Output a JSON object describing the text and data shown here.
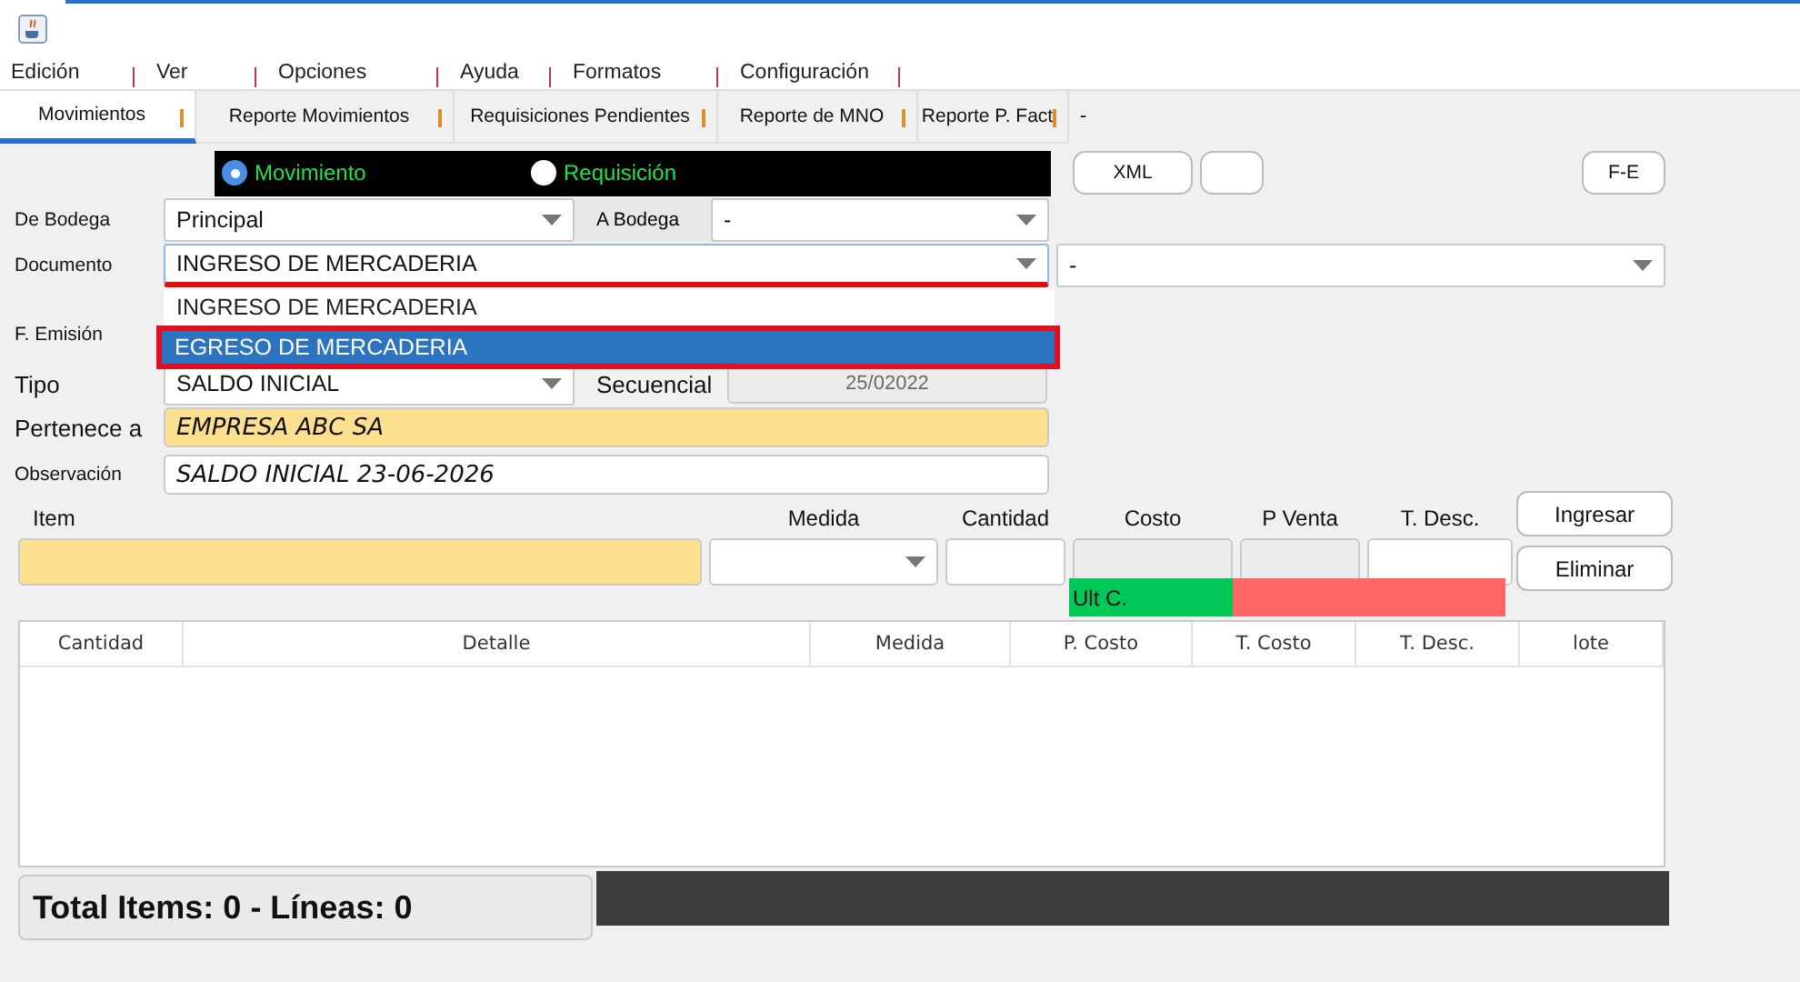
{
  "menu": [
    "Edición",
    "Ver",
    "Opciones",
    "Ayuda",
    "Formatos",
    "Configuración"
  ],
  "tabs": [
    {
      "label": "Movimientos",
      "selected": true
    },
    {
      "label": "Reporte Movimientos",
      "selected": false
    },
    {
      "label": "Requisiciones Pendientes",
      "selected": false
    },
    {
      "label": "Reporte de MNO",
      "selected": false
    },
    {
      "label": "Reporte P. Fact",
      "selected": false
    }
  ],
  "tabs_trailing": "-",
  "mode_radios": [
    {
      "label": "Movimiento",
      "selected": true
    },
    {
      "label": "Requisición",
      "selected": false
    }
  ],
  "xml_button": "XML",
  "fe_button": "F-E",
  "de_bodega": {
    "label": "De Bodega",
    "value": "Principal"
  },
  "a_bodega": {
    "label": "A Bodega",
    "value": "-"
  },
  "documento": {
    "label": "Documento",
    "value": "INGRESO DE MERCADERIA",
    "open": true
  },
  "documento_extra": {
    "value": "-"
  },
  "documento_options": [
    {
      "label": "INGRESO DE MERCADERIA",
      "selected": false
    },
    {
      "label": "EGRESO DE MERCADERIA",
      "selected": true
    }
  ],
  "f_emision": {
    "label": "F. Emisión"
  },
  "tipo": {
    "label": "Tipo",
    "value": "SALDO INICIAL"
  },
  "secuencial": {
    "label": "Secuencial",
    "value": "25/02022",
    "disabled": true
  },
  "pertenece": {
    "label": "Pertenece a",
    "value": "EMPRESA ABC SA"
  },
  "observacion": {
    "label": "Observación",
    "value": "SALDO INICIAL 23-06-2026"
  },
  "entry_fields": [
    {
      "label": "Item",
      "kind": "text",
      "disabled": false
    },
    {
      "label": "Medida",
      "kind": "select",
      "disabled": false
    },
    {
      "label": "Cantidad",
      "kind": "text",
      "disabled": false
    },
    {
      "label": "Costo",
      "kind": "text",
      "disabled": true
    },
    {
      "label": "P Venta",
      "kind": "text",
      "disabled": true
    },
    {
      "label": "T. Desc.",
      "kind": "text",
      "disabled": false
    }
  ],
  "ult_c": "Ult C.",
  "action_buttons": [
    "Ingresar",
    "Eliminar"
  ],
  "table": {
    "columns": [
      "Cantidad",
      "Detalle",
      "Medida",
      "P. Costo",
      "T. Costo",
      "T. Desc.",
      "lote"
    ]
  },
  "totals": "Total Items: 0 - Líneas: 0"
}
